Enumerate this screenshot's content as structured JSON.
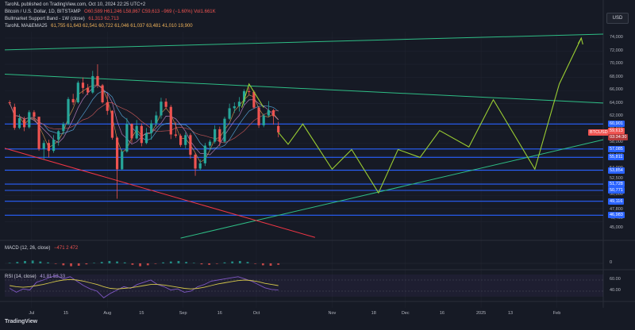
{
  "header": {
    "published": "TaroNL published on TradingView.com, Oct 10, 2024 22:25 UTC+2",
    "symbol": "Bitcoin / U.S. Dollar, 1D, BITSTAMP",
    "ohlc": "O60,589 H61,246 L58,867 C59,613 −969 (−1.60%) Vol1.661K",
    "line2_label": "Bullmarket Support Band - 1W (close)",
    "line2_values": "61,313  62,713",
    "line3_label": "TaroNL MA&EMA25",
    "line3_values": "61,755  61,643  62,541  60,722  61,046  61,037  63,481  41,010  19,900",
    "usd_button": "USD",
    "logo": "TradingView",
    "macd_label": "MACD (12, 26, close)",
    "macd_values": "−471  2  472",
    "rsi_label": "RSI (14, close)",
    "rsi_values": "41.81  52.33"
  },
  "colors": {
    "background": "#161a25",
    "up": "#26a69a",
    "down": "#ef5350",
    "support_line": "#2962ff",
    "projection": "#9acd32",
    "trend_teal": "#2ebd85",
    "trend_red": "#f23645",
    "rsi": "#7e57c2",
    "rsi_ma": "#d4c64a"
  },
  "chart_data": {
    "type": "candlestick",
    "title": "Bitcoin / U.S. Dollar, 1D, BITSTAMP",
    "y_ticks": [
      "74,000",
      "72,000",
      "70,000",
      "68,000",
      "66,000",
      "64,000",
      "62,000",
      "60,000",
      "58,000",
      "56,000",
      "54,000",
      "52,500",
      "50,000",
      "47,800",
      "46,400",
      "45,000"
    ],
    "x_ticks": [
      "Jul",
      "15",
      "Aug",
      "15",
      "Sep",
      "16",
      "Oct",
      "Nov",
      "18",
      "Dec",
      "16",
      "2025",
      "13",
      "Feb"
    ],
    "support_levels": [
      {
        "label": "60,901",
        "value": 60901
      },
      {
        "label": "57,085",
        "value": 57085
      },
      {
        "label": "55,811",
        "value": 55811
      },
      {
        "label": "53,854",
        "value": 53854
      },
      {
        "label": "51,728",
        "value": 51728
      },
      {
        "label": "50,771",
        "value": 50771
      },
      {
        "label": "49,116",
        "value": 49116
      },
      {
        "label": "46,983",
        "value": 46983
      }
    ],
    "price_tag": {
      "label": "BTCUSD",
      "value": "59,613",
      "countdown": "03:34:30"
    },
    "projection_path": [
      [
        "2024-10-10",
        59613
      ],
      [
        "2024-10-14",
        57800
      ],
      [
        "2024-10-20",
        60900
      ],
      [
        "2024-11-01",
        54000
      ],
      [
        "2024-11-09",
        57000
      ],
      [
        "2024-11-20",
        50400
      ],
      [
        "2024-11-28",
        57000
      ],
      [
        "2024-12-07",
        55800
      ],
      [
        "2024-12-15",
        59900
      ],
      [
        "2024-12-27",
        57400
      ],
      [
        "2025-01-06",
        64600
      ],
      [
        "2025-01-23",
        54000
      ],
      [
        "2025-02-02",
        67000
      ],
      [
        "2025-02-11",
        74000
      ]
    ],
    "peak_path": [
      [
        "2024-09-25",
        63400
      ],
      [
        "2024-09-28",
        67000
      ],
      [
        "2024-10-04",
        63400
      ]
    ],
    "trend_lines": [
      {
        "name": "upper-resistance",
        "from": [
          "2024-06-20",
          72200
        ],
        "to": [
          "2025-02-20",
          74600
        ]
      },
      {
        "name": "descending-resistance",
        "from": [
          "2024-06-20",
          68500
        ],
        "to": [
          "2025-02-20",
          64100
        ]
      },
      {
        "name": "rising-support",
        "from": [
          "2024-08-31",
          43500
        ],
        "to": [
          "2025-02-20",
          58500
        ]
      },
      {
        "name": "descending-support",
        "from": [
          "2024-06-20",
          57200
        ],
        "to": [
          "2024-10-25",
          43600
        ]
      }
    ],
    "candles": [
      [
        "2024-06-22",
        64200,
        64500,
        63800,
        64100
      ],
      [
        "2024-06-24",
        63500,
        64000,
        60000,
        60300
      ],
      [
        "2024-06-26",
        60300,
        62400,
        60100,
        61800
      ],
      [
        "2024-06-28",
        61600,
        62000,
        59800,
        60400
      ],
      [
        "2024-06-30",
        60400,
        63000,
        60200,
        62700
      ],
      [
        "2024-07-02",
        62700,
        63000,
        61500,
        62000
      ],
      [
        "2024-07-04",
        62000,
        62000,
        56800,
        57100
      ],
      [
        "2024-07-06",
        57100,
        58400,
        55500,
        58000
      ],
      [
        "2024-07-08",
        58000,
        58500,
        55800,
        56800
      ],
      [
        "2024-07-10",
        56800,
        59200,
        56500,
        58500
      ],
      [
        "2024-07-12",
        58500,
        60000,
        57600,
        59800
      ],
      [
        "2024-07-14",
        59800,
        61200,
        59300,
        60900
      ],
      [
        "2024-07-16",
        60900,
        65000,
        60700,
        64700
      ],
      [
        "2024-07-18",
        64700,
        65500,
        63800,
        64200
      ],
      [
        "2024-07-20",
        64200,
        67500,
        64000,
        67200
      ],
      [
        "2024-07-22",
        67200,
        68000,
        65500,
        66400
      ],
      [
        "2024-07-24",
        66400,
        67000,
        65300,
        65700
      ],
      [
        "2024-07-26",
        65700,
        69000,
        65500,
        68200
      ],
      [
        "2024-07-28",
        68200,
        70000,
        66400,
        66800
      ],
      [
        "2024-07-30",
        66800,
        67000,
        64000,
        64200
      ],
      [
        "2024-08-01",
        64200,
        65500,
        62300,
        62900
      ],
      [
        "2024-08-03",
        62900,
        63000,
        58500,
        58800
      ],
      [
        "2024-08-05",
        58800,
        59000,
        49500,
        54000
      ],
      [
        "2024-08-07",
        54000,
        57000,
        53800,
        56700
      ],
      [
        "2024-08-09",
        56700,
        61800,
        56500,
        60900
      ],
      [
        "2024-08-11",
        60900,
        61000,
        58000,
        58700
      ],
      [
        "2024-08-13",
        58700,
        61500,
        58500,
        60600
      ],
      [
        "2024-08-15",
        60600,
        61000,
        57500,
        58000
      ],
      [
        "2024-08-17",
        58000,
        60300,
        57800,
        59500
      ],
      [
        "2024-08-19",
        59500,
        61500,
        58500,
        61000
      ],
      [
        "2024-08-21",
        61000,
        62800,
        60500,
        62200
      ],
      [
        "2024-08-23",
        62200,
        64900,
        61700,
        64300
      ],
      [
        "2024-08-25",
        64300,
        64800,
        63200,
        63500
      ],
      [
        "2024-08-27",
        63500,
        63800,
        58600,
        59300
      ],
      [
        "2024-08-29",
        59300,
        61200,
        58800,
        59100
      ],
      [
        "2024-08-31",
        59100,
        59400,
        57400,
        57700
      ],
      [
        "2024-09-02",
        57700,
        59600,
        57200,
        59200
      ],
      [
        "2024-09-04",
        59200,
        59500,
        55600,
        56200
      ],
      [
        "2024-09-06",
        56200,
        56500,
        53000,
        54100
      ],
      [
        "2024-09-08",
        54100,
        55500,
        53800,
        54900
      ],
      [
        "2024-09-10",
        54900,
        58000,
        54500,
        57600
      ],
      [
        "2024-09-12",
        57600,
        58500,
        56800,
        58200
      ],
      [
        "2024-09-14",
        58200,
        60700,
        57900,
        60100
      ],
      [
        "2024-09-16",
        60100,
        60500,
        57500,
        58200
      ],
      [
        "2024-09-18",
        58200,
        62000,
        58000,
        61700
      ],
      [
        "2024-09-20",
        61700,
        64000,
        61500,
        63300
      ],
      [
        "2024-09-22",
        63300,
        64200,
        62600,
        63600
      ],
      [
        "2024-09-24",
        63600,
        65000,
        62800,
        64300
      ],
      [
        "2024-09-26",
        64300,
        66200,
        63800,
        65900
      ],
      [
        "2024-09-28",
        65900,
        66500,
        65300,
        65800
      ],
      [
        "2024-09-30",
        65800,
        66000,
        63200,
        63400
      ],
      [
        "2024-10-02",
        63400,
        63600,
        60300,
        60700
      ],
      [
        "2024-10-04",
        60700,
        62500,
        60400,
        62200
      ],
      [
        "2024-10-06",
        62200,
        64400,
        62000,
        63000
      ],
      [
        "2024-10-08",
        63000,
        63200,
        60800,
        62100
      ],
      [
        "2024-10-10",
        60589,
        61246,
        58867,
        59613
      ]
    ],
    "macd": {
      "hist": [
        0.1,
        0.3,
        0.5,
        0.6,
        0.4,
        0.2,
        -0.1,
        -0.4,
        -0.6,
        -0.5,
        -0.2,
        0.1,
        0.3,
        0.5,
        0.4,
        0.2,
        -0.3,
        -0.6,
        -0.4,
        -0.1,
        0.2,
        0.4,
        0.5,
        0.3,
        0.1,
        -0.2,
        -0.3,
        -0.1,
        0.2,
        0.4,
        0.5,
        0.3,
        -0.1,
        -0.4,
        -0.5,
        -0.3
      ]
    },
    "rsi": {
      "values": [
        45,
        38,
        44,
        42,
        56,
        60,
        65,
        68,
        62,
        66,
        58,
        50,
        44,
        40,
        28,
        36,
        42,
        48,
        45,
        52,
        56,
        60,
        52,
        48,
        42,
        44,
        38,
        40,
        48,
        52,
        58,
        60,
        62,
        64,
        66,
        62,
        58,
        52,
        46,
        43,
        42
      ],
      "ma": [
        50,
        48,
        47,
        48,
        50,
        52,
        55,
        58,
        60,
        61,
        60,
        58,
        55,
        52,
        48,
        45,
        44,
        45,
        46,
        48,
        50,
        52,
        52,
        51,
        49,
        47,
        45,
        44,
        45,
        47,
        50,
        53,
        55,
        57,
        59,
        60,
        59,
        57,
        54,
        52,
        50
      ],
      "ticks": [
        "60.00",
        "40.00"
      ]
    }
  }
}
